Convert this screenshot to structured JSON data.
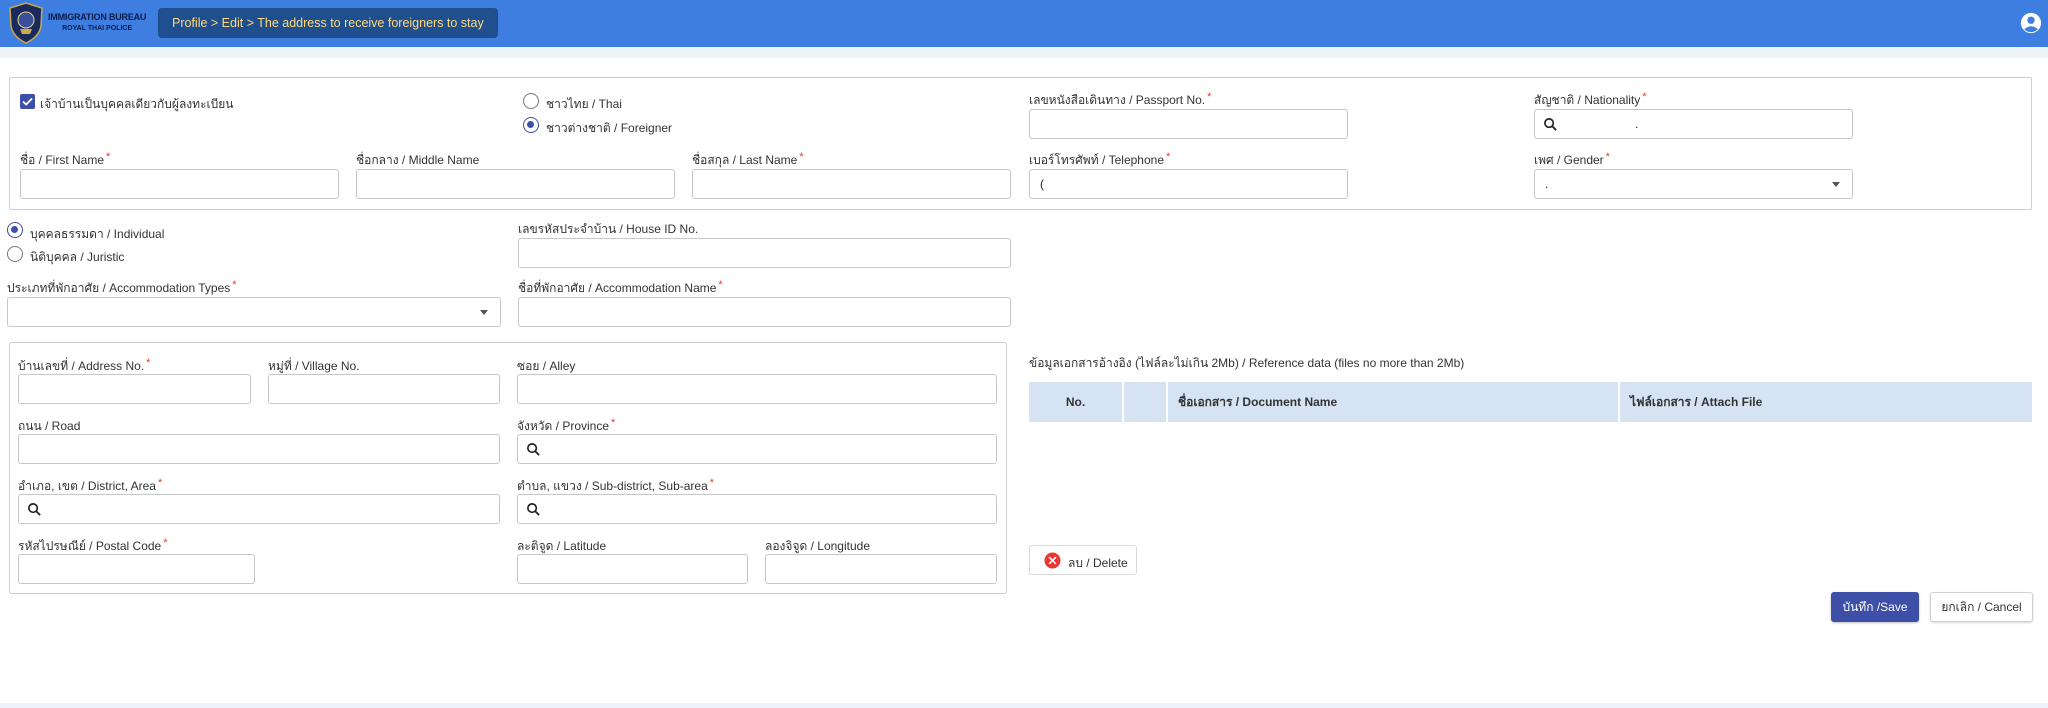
{
  "header": {
    "logo_line1": "IMMIGRATION BUREAU",
    "logo_line2": "ROYAL THAI POLICE",
    "breadcrumb": "Profile > Edit > The address to receive foreigners to stay"
  },
  "owner": {
    "same_person_label": "เจ้าบ้านเป็นบุคคลเดียวกับผู้ลงทะเบียน",
    "same_person_checked": true,
    "nationality_type": {
      "options": [
        "ชาวไทย / Thai",
        "ชาวต่างชาติ / Foreigner"
      ],
      "selected": "ชาวต่างชาติ / Foreigner"
    },
    "passport": {
      "label": "เลขหนังสือเดินทาง / Passport No.",
      "value": ""
    },
    "nationality": {
      "label": "สัญชาติ / Nationality",
      "value": "."
    },
    "first_name": {
      "label": "ชื่อ / First Name",
      "value": ""
    },
    "middle_name": {
      "label": "ชื่อกลาง / Middle Name",
      "value": ""
    },
    "last_name": {
      "label": "ชื่อสกุล / Last Name",
      "value": ""
    },
    "telephone": {
      "label": "เบอร์โทรศัพท์ / Telephone",
      "value": "("
    },
    "gender": {
      "label": "เพศ / Gender",
      "value": "."
    },
    "required_mark": "*"
  },
  "accommodation": {
    "person_type": {
      "options": [
        "บุคคลธรรมดา / Individual",
        "นิติบุคคล / Juristic"
      ],
      "selected": "บุคคลธรรมดา / Individual"
    },
    "house_id": {
      "label": "เลขรหัสประจำบ้าน / House ID No.",
      "value": ""
    },
    "types": {
      "label": "ประเภทที่พักอาศัย / Accommodation Types",
      "value": ""
    },
    "name": {
      "label": "ชื่อที่พักอาศัย / Accommodation Name",
      "value": ""
    }
  },
  "address": {
    "address_no": {
      "label": "บ้านเลขที่ / Address No.",
      "value": ""
    },
    "village_no": {
      "label": "หมู่ที่ / Village No.",
      "value": ""
    },
    "alley": {
      "label": "ซอย / Alley",
      "value": ""
    },
    "road": {
      "label": "ถนน / Road",
      "value": ""
    },
    "province": {
      "label": "จังหวัด / Province",
      "value": ""
    },
    "district": {
      "label": "อำเภอ, เขต / District, Area",
      "value": ""
    },
    "sub_district": {
      "label": "ตำบล, แขวง / Sub-district, Sub-area",
      "value": ""
    },
    "postal_code": {
      "label": "รหัสไปรษณีย์ / Postal Code",
      "value": ""
    },
    "latitude": {
      "label": "ละติจูด / Latitude",
      "value": ""
    },
    "longitude": {
      "label": "ลองจิจูด / Longitude",
      "value": ""
    }
  },
  "reference": {
    "title": "ข้อมูลเอกสารอ้างอิง (ไฟล์ละไม่เกิน 2Mb) / Reference data (files no more than 2Mb)",
    "columns": [
      "No.",
      "",
      "ชื่อเอกสาร / Document Name",
      "ไฟล์เอกสาร / Attach File"
    ],
    "delete_label": "ลบ / Delete"
  },
  "actions": {
    "save_label": "บันทึก /Save",
    "cancel_label": "ยกเลิก / Cancel"
  },
  "colors": {
    "topbar": "#3d7ee0",
    "breadcrumb_bg": "#1f4f8f",
    "breadcrumb_text": "#ffd97a",
    "primary": "#3e4fa7",
    "table_header": "#d6e3f3",
    "required": "#e53935"
  }
}
